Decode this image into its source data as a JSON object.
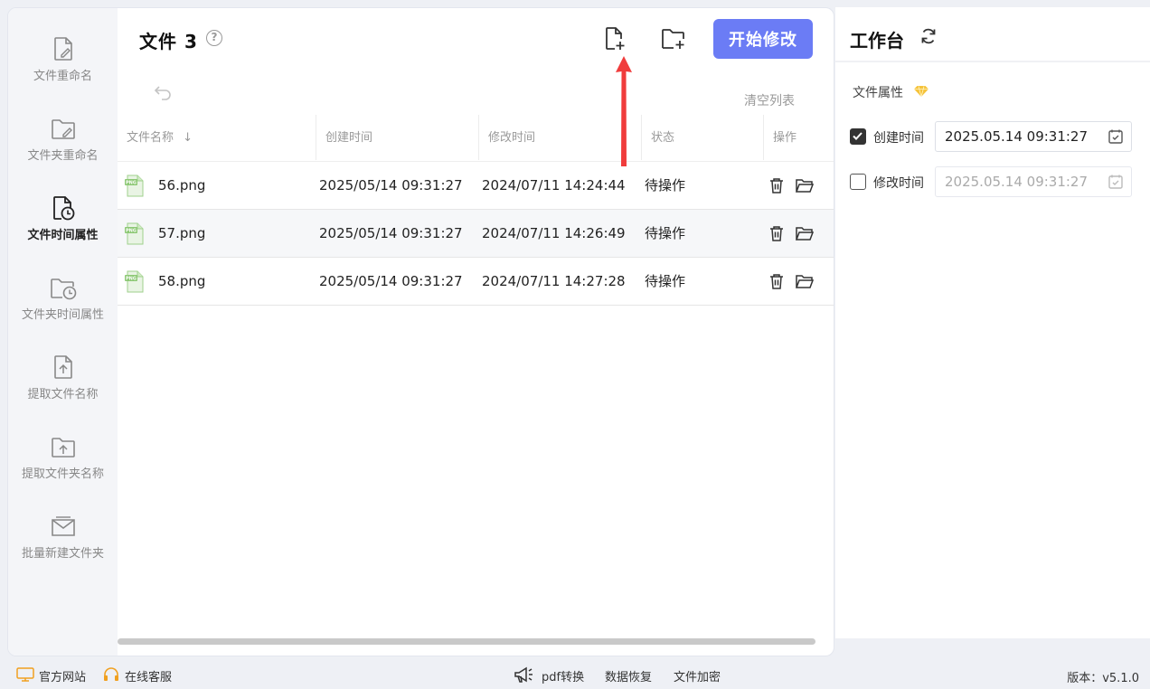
{
  "sidebar": {
    "items": [
      {
        "label": "文件重命名",
        "icon": "file-edit-icon"
      },
      {
        "label": "文件夹重命名",
        "icon": "folder-edit-icon"
      },
      {
        "label": "文件时间属性",
        "icon": "file-clock-icon",
        "active": true
      },
      {
        "label": "文件夹时间属性",
        "icon": "folder-clock-icon"
      },
      {
        "label": "提取文件名称",
        "icon": "file-upload-icon"
      },
      {
        "label": "提取文件夹名称",
        "icon": "folder-upload-icon"
      },
      {
        "label": "批量新建文件夹",
        "icon": "folder-mail-icon"
      }
    ]
  },
  "main": {
    "title": "文件 3",
    "start_button": "开始修改",
    "clear_list": "清空列表",
    "columns": [
      "文件名称",
      "创建时间",
      "修改时间",
      "状态",
      "操作"
    ],
    "rows": [
      {
        "name": "56.png",
        "created": "2025/05/14 09:31:27",
        "modified": "2024/07/11 14:24:44",
        "status": "待操作"
      },
      {
        "name": "57.png",
        "created": "2025/05/14 09:31:27",
        "modified": "2024/07/11 14:26:49",
        "status": "待操作"
      },
      {
        "name": "58.png",
        "created": "2025/05/14 09:31:27",
        "modified": "2024/07/11 14:27:28",
        "status": "待操作"
      }
    ],
    "file_badge": "PNG"
  },
  "panel": {
    "title": "工作台",
    "section": "文件属性",
    "create_time": {
      "label": "创建时间",
      "value": "2025.05.14 09:31:27",
      "checked": true
    },
    "modify_time": {
      "label": "修改时间",
      "value": "2025.05.14 09:31:27",
      "checked": false
    }
  },
  "footer": {
    "website": "官方网站",
    "support": "在线客服",
    "pdf": "pdf转换",
    "recovery": "数据恢复",
    "encrypt": "文件加密",
    "version": "版本：v5.1.0"
  },
  "colors": {
    "accent": "#6b7cf5",
    "arrow": "#f03c3c",
    "gem": "#f5c33b"
  }
}
